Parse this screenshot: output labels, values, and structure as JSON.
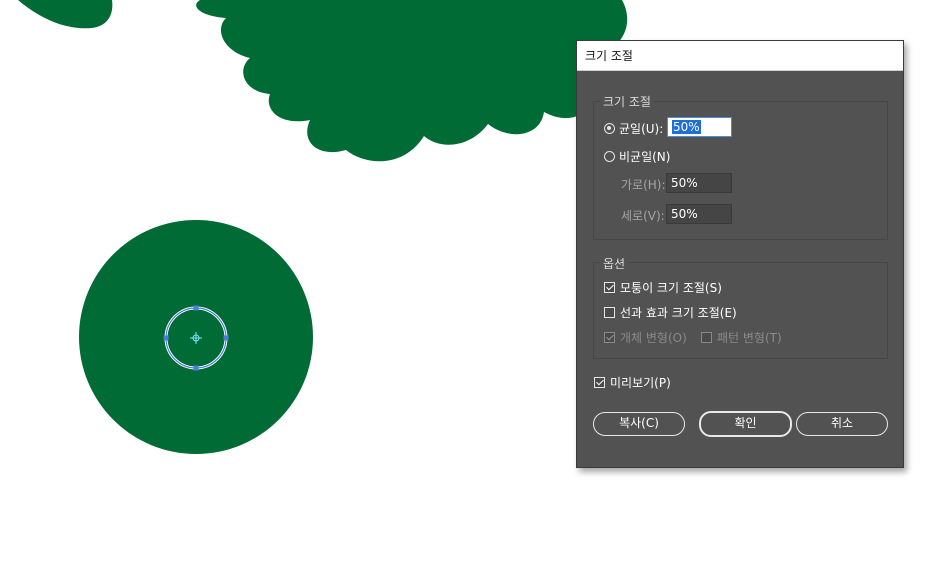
{
  "dialog": {
    "title": "크기 조절",
    "scale_group_label": "크기 조절",
    "uniform_label": "균일(U):",
    "uniform_value": "50%",
    "uniform_selected": true,
    "nonuniform_label": "비균일(N)",
    "horizontal_label": "가로(H):",
    "horizontal_value": "50%",
    "vertical_label": "세로(V):",
    "vertical_value": "50%",
    "options_group_label": "옵션",
    "scale_corners_label": "모퉁이 크기 조절(S)",
    "scale_corners_checked": true,
    "scale_strokes_label": "선과 효과 크기 조절(E)",
    "scale_strokes_checked": false,
    "transform_objects_label": "개체 변형(O)",
    "transform_objects_checked": true,
    "transform_patterns_label": "패턴 변형(T)",
    "transform_patterns_checked": false,
    "preview_label": "미리보기(P)",
    "preview_checked": true,
    "copy_button": "복사(C)",
    "ok_button": "확인",
    "cancel_button": "취소"
  },
  "colors": {
    "artwork_green": "#006b35",
    "selection_blue": "#4a7fd9",
    "dialog_bg": "#525252"
  }
}
